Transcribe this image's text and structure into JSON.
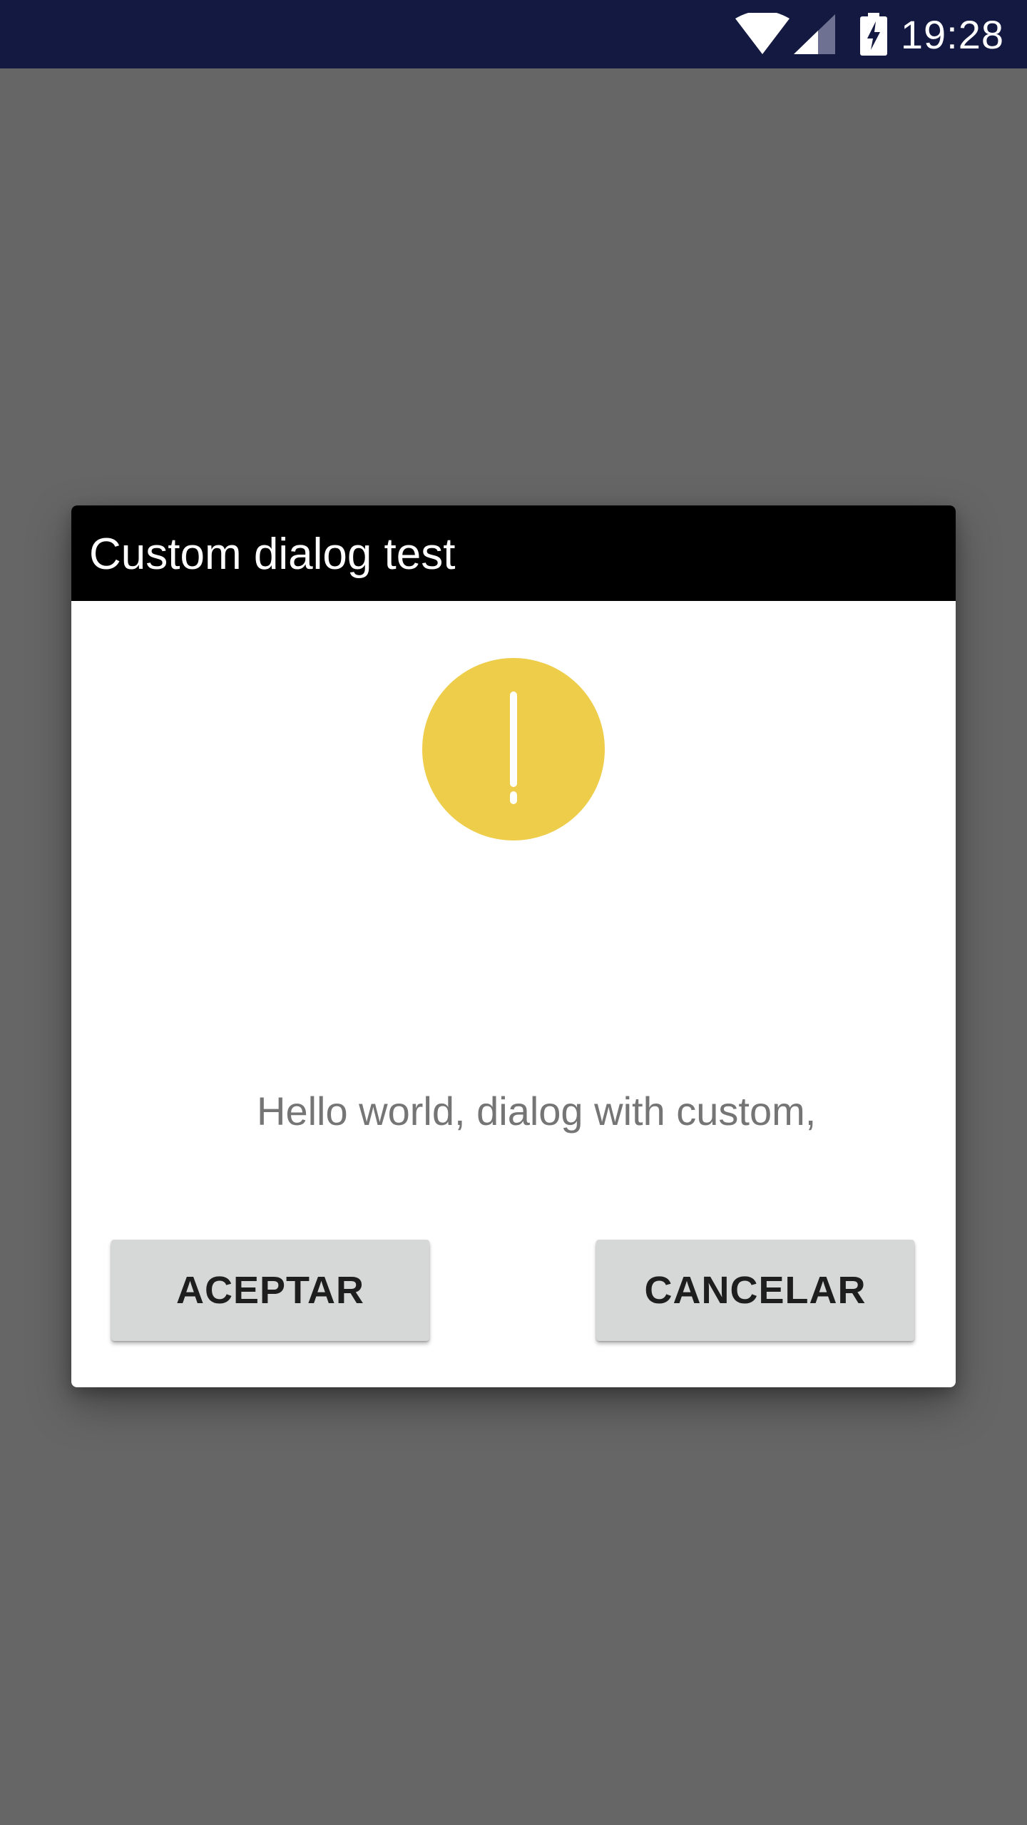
{
  "status_bar": {
    "time": "19:28",
    "wifi_icon": "wifi-icon",
    "signal_icon": "cell-signal-icon",
    "battery_icon": "battery-charging-icon",
    "background_color": "#141941"
  },
  "dialog": {
    "title": "Custom dialog test",
    "icon": "warning-exclamation-icon",
    "icon_color": "#EECD4B",
    "message": "Hello world, dialog with custom,",
    "accept_label": "ACEPTAR",
    "cancel_label": "CANCELAR"
  },
  "colors": {
    "scrim": "#666666",
    "header": "#000000",
    "button": "#D6D7D7"
  }
}
